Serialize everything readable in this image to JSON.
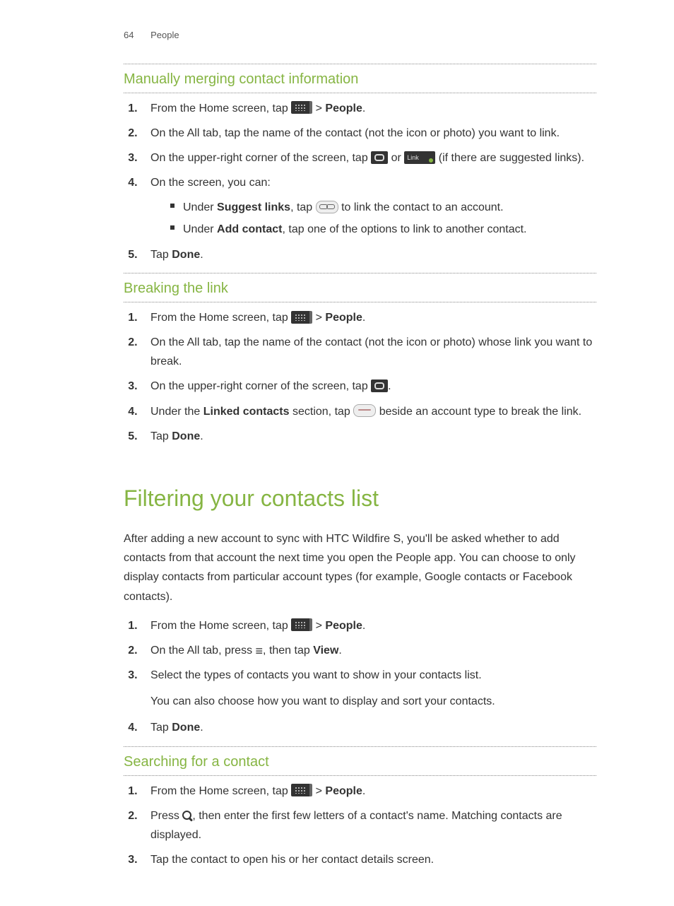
{
  "header": {
    "page_number": "64",
    "section": "People"
  },
  "section_a": {
    "title": "Manually merging contact information",
    "steps": {
      "s1_a": "From the Home screen, tap ",
      "s1_b": " > ",
      "s1_c": "People",
      "s1_d": ".",
      "s2": "On the All tab, tap the name of the contact (not the icon or photo) you want to link.",
      "s3_a": "On the upper-right corner of the screen, tap ",
      "s3_b": " or ",
      "s3_c": " (if there are suggested links).",
      "s4": "On the screen, you can:",
      "s4_sub1_a": "Under ",
      "s4_sub1_b": "Suggest links",
      "s4_sub1_c": ", tap ",
      "s4_sub1_d": " to link the contact to an account.",
      "s4_sub2_a": "Under ",
      "s4_sub2_b": "Add contact",
      "s4_sub2_c": ", tap one of the options to link to another contact.",
      "s5_a": "Tap ",
      "s5_b": "Done",
      "s5_c": "."
    }
  },
  "section_b": {
    "title": "Breaking the link",
    "steps": {
      "s1_a": "From the Home screen, tap ",
      "s1_b": " > ",
      "s1_c": "People",
      "s1_d": ".",
      "s2": "On the All tab, tap the name of the contact (not the icon or photo) whose link you want to break.",
      "s3_a": "On the upper-right corner of the screen, tap ",
      "s3_b": ".",
      "s4_a": "Under the ",
      "s4_b": "Linked contacts",
      "s4_c": " section, tap ",
      "s4_d": " beside an account type to break the link.",
      "s5_a": "Tap ",
      "s5_b": "Done",
      "s5_c": "."
    }
  },
  "section_c": {
    "title": "Filtering your contacts list",
    "intro": "After adding a new account to sync with HTC Wildfire S, you'll be asked whether to add contacts from that account the next time you open the People app. You can choose to only display contacts from particular account types (for example, Google contacts or Facebook contacts).",
    "steps": {
      "s1_a": "From the Home screen, tap ",
      "s1_b": " > ",
      "s1_c": "People",
      "s1_d": ".",
      "s2_a": "On the All tab, press ",
      "s2_b": ", then tap ",
      "s2_c": "View",
      "s2_d": ".",
      "s3": "Select the types of contacts you want to show in your contacts list.",
      "s3_note": "You can also choose how you want to display and sort your contacts.",
      "s4_a": "Tap ",
      "s4_b": "Done",
      "s4_c": "."
    }
  },
  "section_d": {
    "title": "Searching for a contact",
    "steps": {
      "s1_a": "From the Home screen, tap ",
      "s1_b": " > ",
      "s1_c": "People",
      "s1_d": ".",
      "s2_a": "Press ",
      "s2_b": ", then enter the first few letters of a contact's name. Matching contacts are displayed.",
      "s3": "Tap the contact to open his or her contact details screen."
    }
  },
  "link_suggest_label": "Link"
}
